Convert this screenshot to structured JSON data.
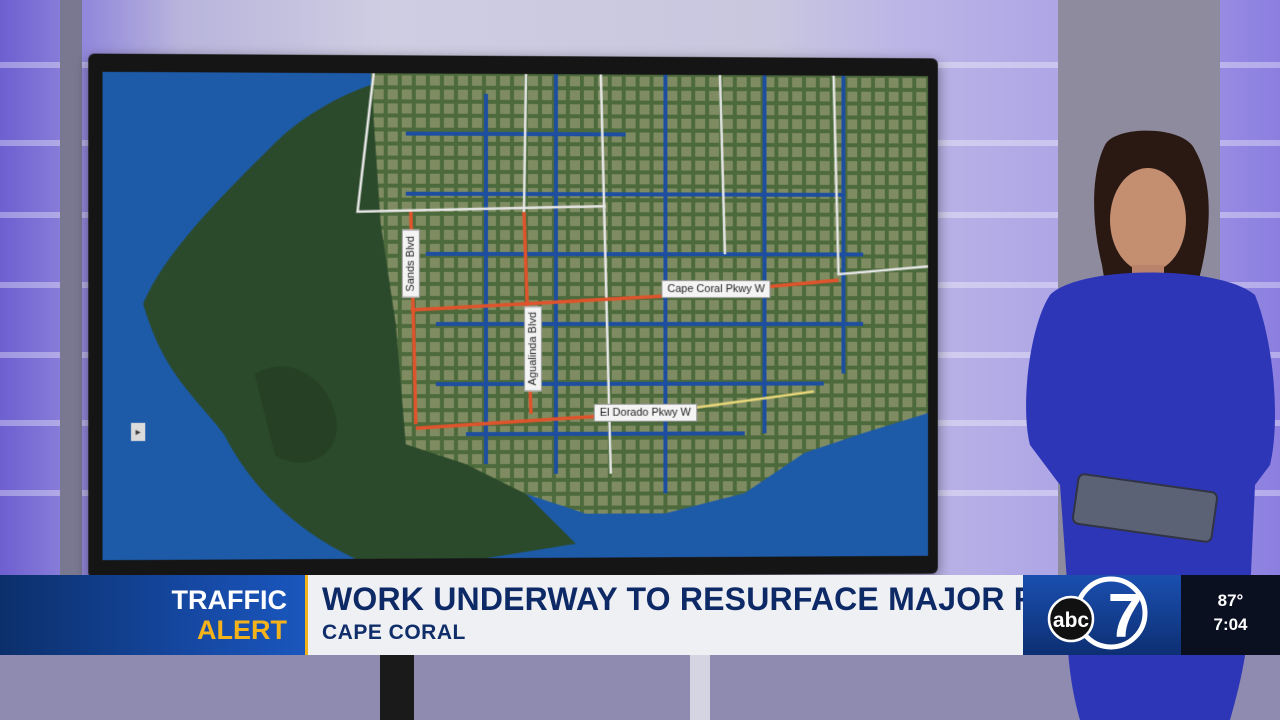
{
  "map": {
    "roads": {
      "sands": "Sands Blvd",
      "agualinda": "Agualinda Blvd",
      "cape_coral": "Cape Coral Pkwy W",
      "el_dorado": "El Dorado Pkwy W"
    },
    "road_color": "#e0532b",
    "water_color": "#1d5aa8",
    "land_color": "#2a4a2a"
  },
  "lower_third": {
    "alert_line1": "TRAFFIC",
    "alert_line2": "ALERT",
    "headline": "WORK UNDERWAY TO RESURFACE MAJOR ROADS",
    "location": "CAPE CORAL",
    "logo_text": "abc",
    "logo_number": "7",
    "temperature": "87°",
    "time": "7:04"
  },
  "colors": {
    "brand_blue": "#0e2a66",
    "accent_yellow": "#f5b31b"
  }
}
